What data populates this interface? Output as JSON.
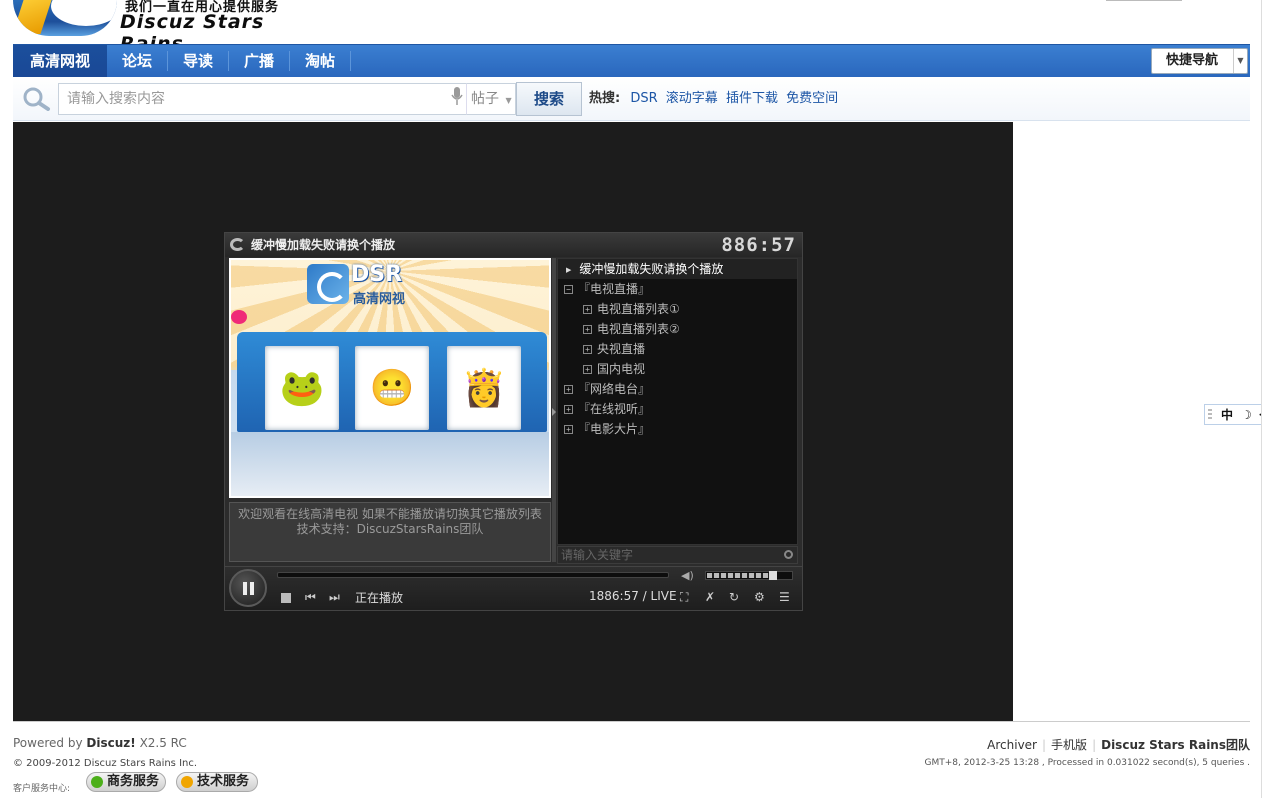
{
  "header": {
    "slogan": "我们一直在用心提供服务",
    "site_name": "Discuz Stars Rains"
  },
  "nav": {
    "items": [
      {
        "label": "高清网视",
        "active": true
      },
      {
        "label": "论坛"
      },
      {
        "label": "导读"
      },
      {
        "label": "广播"
      },
      {
        "label": "淘帖"
      }
    ],
    "quick_nav_label": "快捷导航"
  },
  "search": {
    "placeholder": "请输入搜索内容",
    "type_selected": "帖子",
    "button_label": "搜索",
    "hot_label": "热搜:",
    "hot_terms": [
      "DSR",
      "滚动字幕",
      "插件下载",
      "免费空间"
    ]
  },
  "player": {
    "title": "缓冲慢加载失败请换个播放",
    "clock": "886:57",
    "logo_text": "DSR",
    "logo_subtitle": "高清网视",
    "caption_line1": "欢迎观看在线高清电视 如果不能播放请切换其它播放列表",
    "caption_line2": "技术支持：DiscuzStarsRains团队",
    "playlist": [
      {
        "label": "缓冲慢加载失败请换个播放",
        "level": 0,
        "type": "item",
        "selected": true
      },
      {
        "label": "『电视直播』",
        "level": 0,
        "type": "group",
        "expanded": true
      },
      {
        "label": "电视直播列表①",
        "level": 1,
        "type": "group"
      },
      {
        "label": "电视直播列表②",
        "level": 1,
        "type": "group"
      },
      {
        "label": "央视直播",
        "level": 1,
        "type": "group"
      },
      {
        "label": "国内电视",
        "level": 1,
        "type": "group"
      },
      {
        "label": "『网络电台』",
        "level": 0,
        "type": "group"
      },
      {
        "label": "『在线视听』",
        "level": 0,
        "type": "group"
      },
      {
        "label": "『电影大片』",
        "level": 0,
        "type": "group"
      }
    ],
    "playlist_search_placeholder": "请输入关键字",
    "status": "正在播放",
    "time": "1886:57 / LIVE",
    "volume_level": 0.75
  },
  "ime": {
    "mode": "中"
  },
  "footer": {
    "powered_prefix": "Powered by",
    "powered_brand": "Discuz!",
    "powered_version": "X2.5 RC",
    "copyright": "© 2009-2012 Discuz Stars Rains Inc.",
    "customer_service": "客户服务中心:",
    "badge_business": "商务服务",
    "badge_tech": "技术服务",
    "links": [
      "Archiver",
      "手机版",
      "Discuz Stars Rains团队"
    ],
    "meta": "GMT+8, 2012-3-25 13:28 , Processed in 0.031022 second(s), 5 queries ."
  },
  "colors": {
    "nav_blue": "#2a67bd",
    "link_blue": "#1d56a6",
    "stage_bg": "#1c1c1c",
    "badge_business_dot": "#4caf1a",
    "badge_tech_dot": "#f0a500"
  }
}
